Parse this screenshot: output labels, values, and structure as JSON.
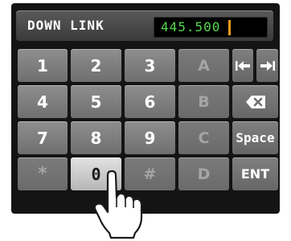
{
  "display": {
    "label": "DOWN LINK",
    "frequency": "445.500"
  },
  "keypad": {
    "row1": [
      "1",
      "2",
      "3",
      "A"
    ],
    "row2": [
      "4",
      "5",
      "6",
      "B"
    ],
    "row3": [
      "7",
      "8",
      "9",
      "C"
    ],
    "row4": [
      "*",
      "0",
      "#",
      "D"
    ],
    "space_label": "Space",
    "ent_label": "ENT"
  },
  "icons": {
    "cursor_left": "cursor-left-icon",
    "cursor_right": "cursor-right-icon",
    "backspace": "backspace-icon",
    "hand": "pointing-hand-icon"
  },
  "colors": {
    "frequency_text": "#57d84f",
    "cursor": "#f39a1a"
  }
}
